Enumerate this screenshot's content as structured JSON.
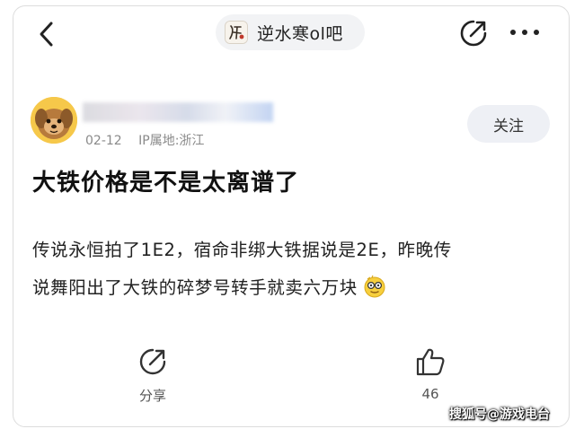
{
  "topbar": {
    "forum_name": "逆水寒ol吧"
  },
  "author": {
    "date": "02-12",
    "ip_location": "IP属地:浙江",
    "follow_label": "关注"
  },
  "post": {
    "title": "大铁价格是不是太离谱了",
    "body_line1": "传说永恒拍了1E2，宿命非绑大铁据说是2E，昨晚传",
    "body_line2": "说舞阳出了大铁的碎梦号转手就卖六万块"
  },
  "actions": {
    "share_label": "分享",
    "like_count": "46"
  },
  "watermark": "搜狐号@游戏电台",
  "icons": {
    "back": "back-chevron-icon",
    "share": "share-icon",
    "more": "more-dots-icon",
    "like": "thumbs-up-icon",
    "emoji": "nerd-smiley-icon"
  },
  "colors": {
    "follow_bg": "#eef0f5",
    "pill_bg": "#f2f3f5",
    "meta_text": "#8a8a8a"
  }
}
